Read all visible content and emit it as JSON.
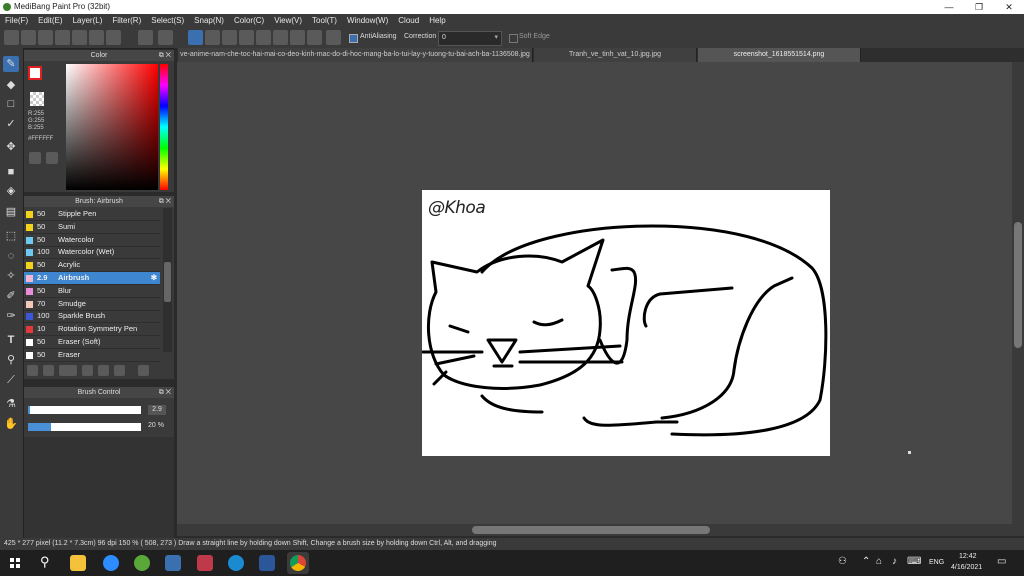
{
  "window": {
    "title": "MediBang Paint Pro (32bit)",
    "minimize_glyph": "—",
    "restore_glyph": "❐",
    "close_glyph": "✕"
  },
  "menu": [
    "File(F)",
    "Edit(E)",
    "Layer(L)",
    "Filter(R)",
    "Select(S)",
    "Snap(N)",
    "Color(C)",
    "View(V)",
    "Tool(T)",
    "Window(W)",
    "Cloud",
    "Help"
  ],
  "toolbar": {
    "antialiasing_label": "AntiAliasing",
    "correction_label": "Correction",
    "correction_value": "0",
    "soft_edge_label": "Soft Edge"
  },
  "color_panel": {
    "title": "Color",
    "r": "R:255",
    "g": "G:255",
    "b": "B:255",
    "hex": "#FFFFFF"
  },
  "brush_panel": {
    "title": "Brush: Airbrush",
    "items": [
      {
        "size": "50",
        "name": "Stipple Pen",
        "color": "#f2d21b"
      },
      {
        "size": "50",
        "name": "Sumi",
        "color": "#f2d21b"
      },
      {
        "size": "50",
        "name": "Watercolor",
        "color": "#6ec9f0"
      },
      {
        "size": "100",
        "name": "Watercolor (Wet)",
        "color": "#6ec9f0"
      },
      {
        "size": "50",
        "name": "Acrylic",
        "color": "#f2d21b"
      },
      {
        "size": "2.9",
        "name": "Airbrush",
        "color": "#f7b6cf"
      },
      {
        "size": "50",
        "name": "Blur",
        "color": "#e98cd9"
      },
      {
        "size": "70",
        "name": "Smudge",
        "color": "#f2c9b8"
      },
      {
        "size": "100",
        "name": "Sparkle Brush",
        "color": "#3b57d6"
      },
      {
        "size": "10",
        "name": "Rotation Symmetry Pen",
        "color": "#e23a3a"
      },
      {
        "size": "50",
        "name": "Eraser (Soft)",
        "color": "#ffffff"
      },
      {
        "size": "50",
        "name": "Eraser",
        "color": "#ffffff"
      }
    ]
  },
  "brush_control": {
    "title": "Brush Control",
    "size_value": "2.9",
    "opacity_value": "20 %",
    "size_fraction": 0.02,
    "opacity_fraction": 0.2
  },
  "tabs": [
    {
      "label": "ve-anime-nam-che-toc-hai-mai-co-deo-kinh-mac-do-di-hoc-mang-ba-lo-tui-lay-y-tuong-tu-bai-ach-ba-1136508.jpg"
    },
    {
      "label": "Tranh_ve_tinh_vat_10.jpg.jpg"
    },
    {
      "label": "screenshot_1618551514.png"
    }
  ],
  "canvas": {
    "signature_text": "@Khoa"
  },
  "status": {
    "text": "425 * 277 pixel  (11.2 * 7.3cm)  96 dpi  150 %  ( 508, 273 )  Draw a straight line by holding down Shift, Change a brush size by holding down Ctrl, Alt, and dragging"
  },
  "taskbar": {
    "language": "ENG",
    "time": "12:42",
    "date": "4/16/2021"
  }
}
